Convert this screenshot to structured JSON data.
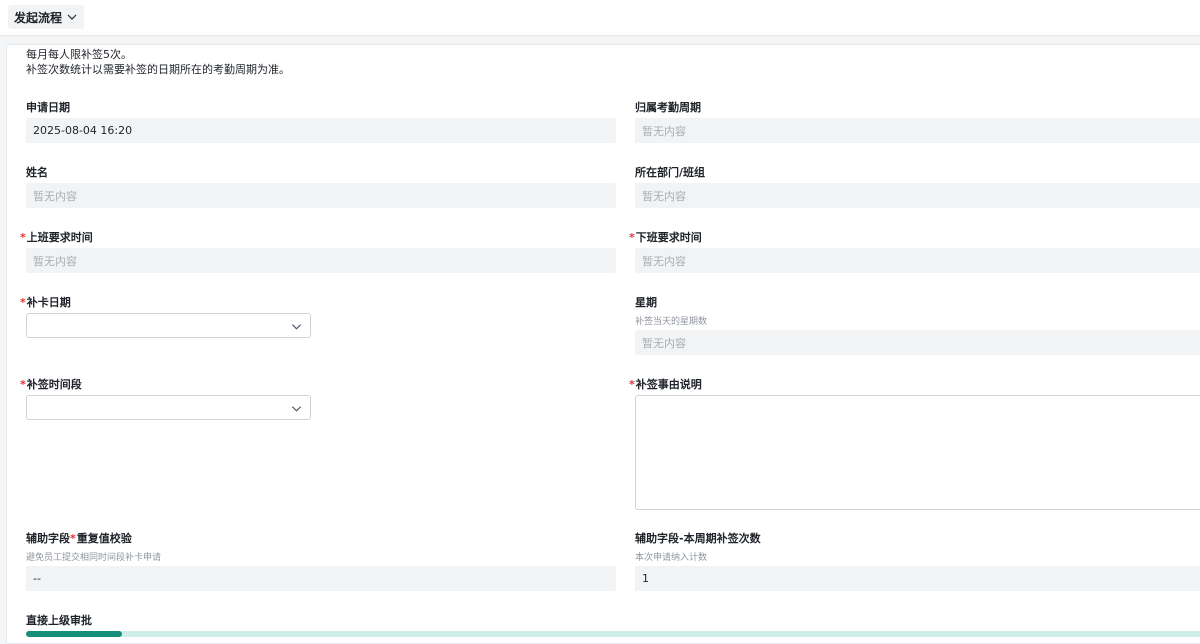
{
  "toolbar": {
    "flow_label": "发起流程"
  },
  "notice": {
    "line1": "每月每人限补签5次。",
    "line2": "补签次数统计以需要补签的日期所在的考勤周期为准。"
  },
  "fields": {
    "apply_date": {
      "label": "申请日期",
      "value": "2025-08-04 16:20"
    },
    "attendance_period": {
      "label": "归属考勤周期",
      "value": "暂无内容"
    },
    "name": {
      "label": "姓名",
      "value": "暂无内容"
    },
    "department": {
      "label": "所在部门/班组",
      "value": "暂无内容"
    },
    "work_start": {
      "required": "*",
      "label": "上班要求时间",
      "value": "暂无内容"
    },
    "work_end": {
      "required": "*",
      "label": "下班要求时间",
      "value": "暂无内容"
    },
    "card_date": {
      "required": "*",
      "label": "补卡日期",
      "value": ""
    },
    "weekday": {
      "label": "星期",
      "hint": "补签当天的星期数",
      "value": "暂无内容"
    },
    "time_slot": {
      "required": "*",
      "label": "补签时间段",
      "value": ""
    },
    "reason": {
      "required": "*",
      "label": "补签事由说明",
      "value": ""
    },
    "dup_check": {
      "label_a": "辅助字段",
      "label_req": "*",
      "label_b": "重复值校验",
      "hint": "避免员工提交相同时间段补卡申请",
      "value": "--"
    },
    "period_count": {
      "label": "辅助字段-本周期补签次数",
      "hint": "本次申请纳入计数",
      "value": "1"
    }
  },
  "approval": {
    "label": "直接上级审批",
    "progress_color": "#15907a",
    "track_color": "#cfeee8"
  },
  "colors": {
    "required": "#e03434",
    "readonly_bg": "#f2f3f5",
    "placeholder": "#a8adb4"
  },
  "icons": {
    "dropdown": "chevron-down-icon"
  }
}
